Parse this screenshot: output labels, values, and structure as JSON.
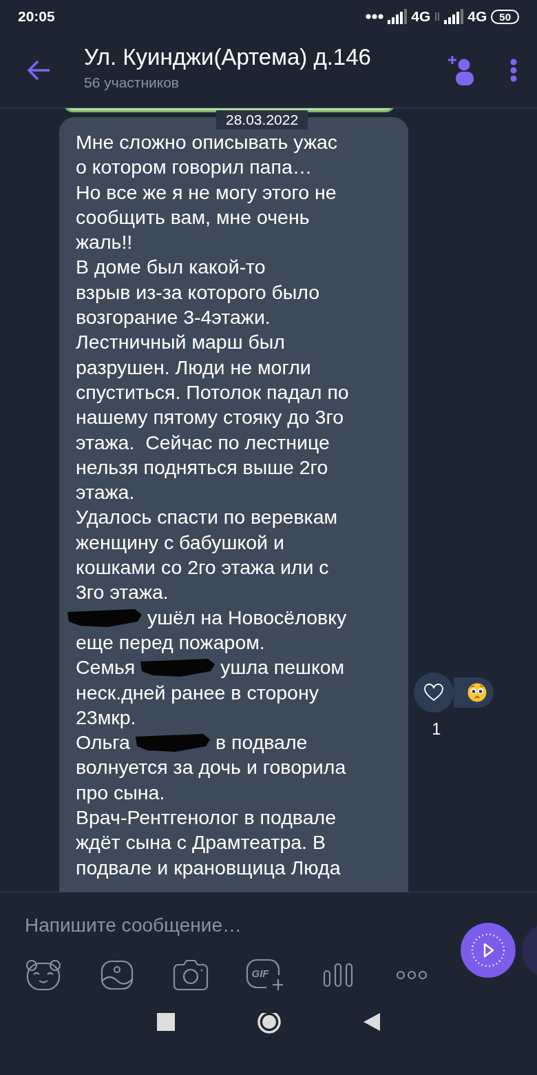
{
  "status_bar": {
    "time": "20:05",
    "network_1": "4G",
    "network_2": "4G",
    "battery": "50"
  },
  "header": {
    "title": "Ул. Куинджи(Артема) д.146",
    "subtitle": "56 участников"
  },
  "date_pill": "28.03.2022",
  "message": {
    "lines": [
      {
        "kind": "text",
        "text": "Мне сложно описывать ужас"
      },
      {
        "kind": "text",
        "text": "о котором говорил папа…"
      },
      {
        "kind": "text",
        "text": "Но все же я не могу этого не"
      },
      {
        "kind": "text",
        "text": "сообщить вам, мне очень"
      },
      {
        "kind": "text",
        "text": "жаль!!"
      },
      {
        "kind": "text",
        "text": "В доме был какой-то"
      },
      {
        "kind": "text",
        "text": "взрыв из-за которого было"
      },
      {
        "kind": "text",
        "text": "возгорание 3-4этажи."
      },
      {
        "kind": "text",
        "text": "Лестничный марш был"
      },
      {
        "kind": "text",
        "text": "разрушен. Люди не могли"
      },
      {
        "kind": "text",
        "text": "спуститься. Потолок падал по"
      },
      {
        "kind": "text",
        "text": "нашему пятому стояку до 3го"
      },
      {
        "kind": "text",
        "text": "этажа.  Сейчас по лестнице"
      },
      {
        "kind": "text",
        "text": "нельзя подняться выше 2го"
      },
      {
        "kind": "text",
        "text": "этажа."
      },
      {
        "kind": "text",
        "text": "Удалось спасти по веревкам"
      },
      {
        "kind": "text",
        "text": "женщину с бабушкой и"
      },
      {
        "kind": "text",
        "text": "кошками со 2го этажа или с"
      },
      {
        "kind": "text",
        "text": "3го этажа."
      },
      {
        "kind": "redacted",
        "after": "ушёл на Новосёловку"
      },
      {
        "kind": "text",
        "text": "еще перед пожаром."
      },
      {
        "kind": "redacted",
        "before": "Семья",
        "after": "ушла пешком"
      },
      {
        "kind": "text",
        "text": "неск.дней ранее в сторону"
      },
      {
        "kind": "text",
        "text": "23мкр."
      },
      {
        "kind": "redacted",
        "before": "Ольга",
        "after": "в подвале"
      },
      {
        "kind": "text",
        "text": "волнуется за дочь и говорила"
      },
      {
        "kind": "text",
        "text": "про сына."
      },
      {
        "kind": "text",
        "text": "Врач-Рентгенолог в подвале"
      },
      {
        "kind": "text",
        "text": "ждёт сына с Драмтеатра. В"
      },
      {
        "kind": "text",
        "text": "подвале и крановщица Люда"
      }
    ],
    "reaction_count": "1"
  },
  "composer": {
    "placeholder": "Напишите сообщение…",
    "gif_label": "GIF"
  }
}
